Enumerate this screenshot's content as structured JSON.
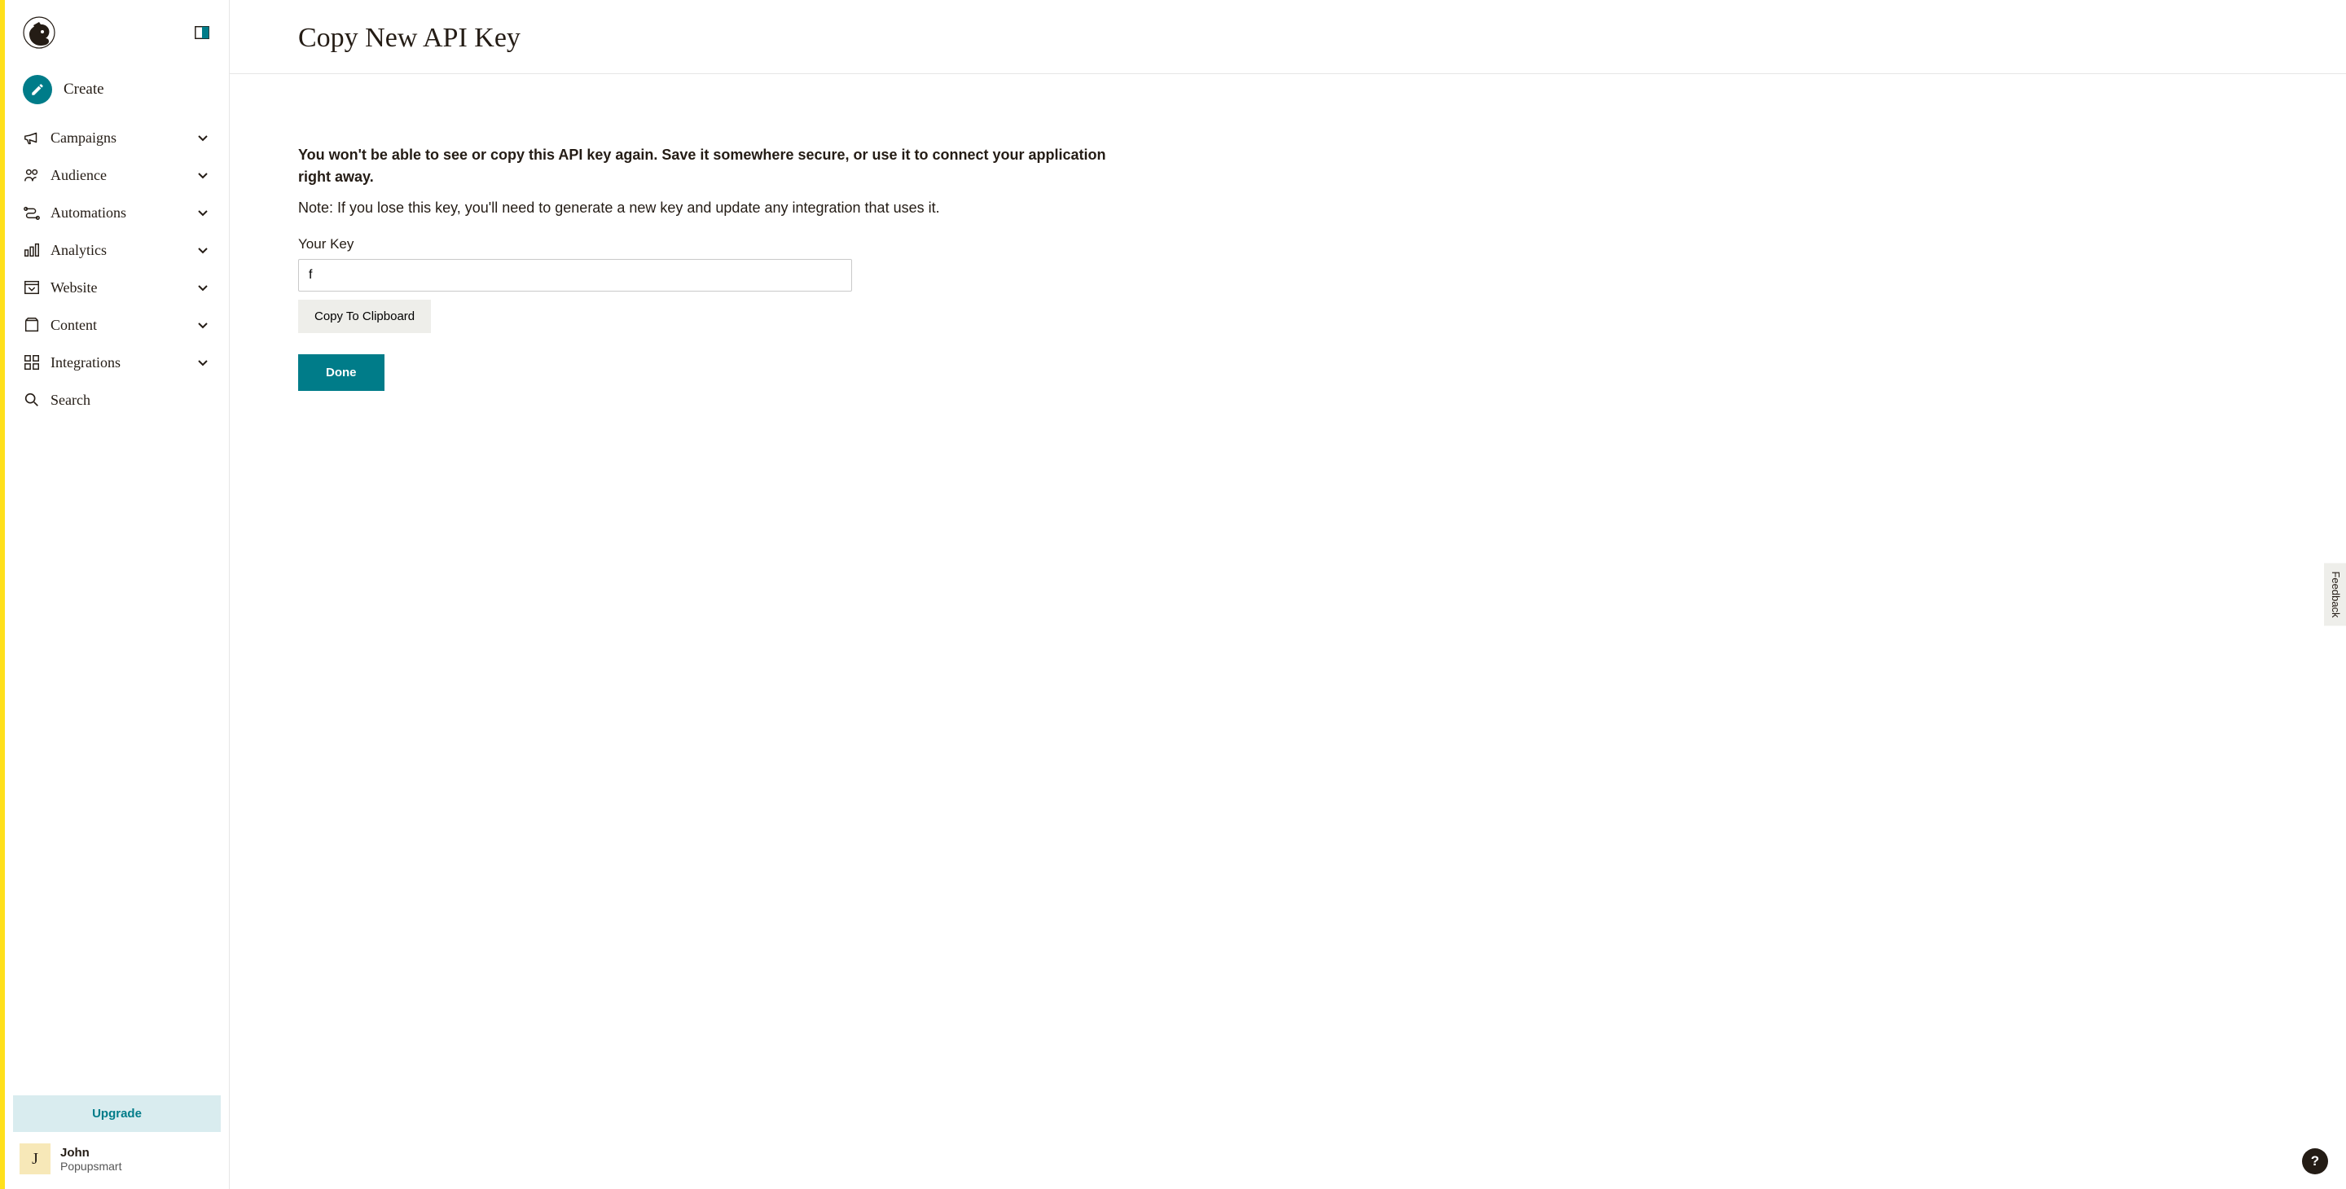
{
  "sidebar": {
    "create_label": "Create",
    "items": [
      {
        "label": "Campaigns"
      },
      {
        "label": "Audience"
      },
      {
        "label": "Automations"
      },
      {
        "label": "Analytics"
      },
      {
        "label": "Website"
      },
      {
        "label": "Content"
      },
      {
        "label": "Integrations"
      },
      {
        "label": "Search"
      }
    ],
    "upgrade_label": "Upgrade",
    "profile": {
      "initial": "J",
      "name": "John",
      "org": "Popupsmart"
    }
  },
  "page": {
    "title": "Copy New API Key",
    "warning": "You won't be able to see or copy this API key again. Save it somewhere secure, or use it to connect your application right away.",
    "note": "Note: If you lose this key, you'll need to generate a new key and update any integration that uses it.",
    "field_label": "Your Key",
    "key_value": "f",
    "copy_label": "Copy To Clipboard",
    "done_label": "Done"
  },
  "feedback_label": "Feedback",
  "help_label": "?"
}
